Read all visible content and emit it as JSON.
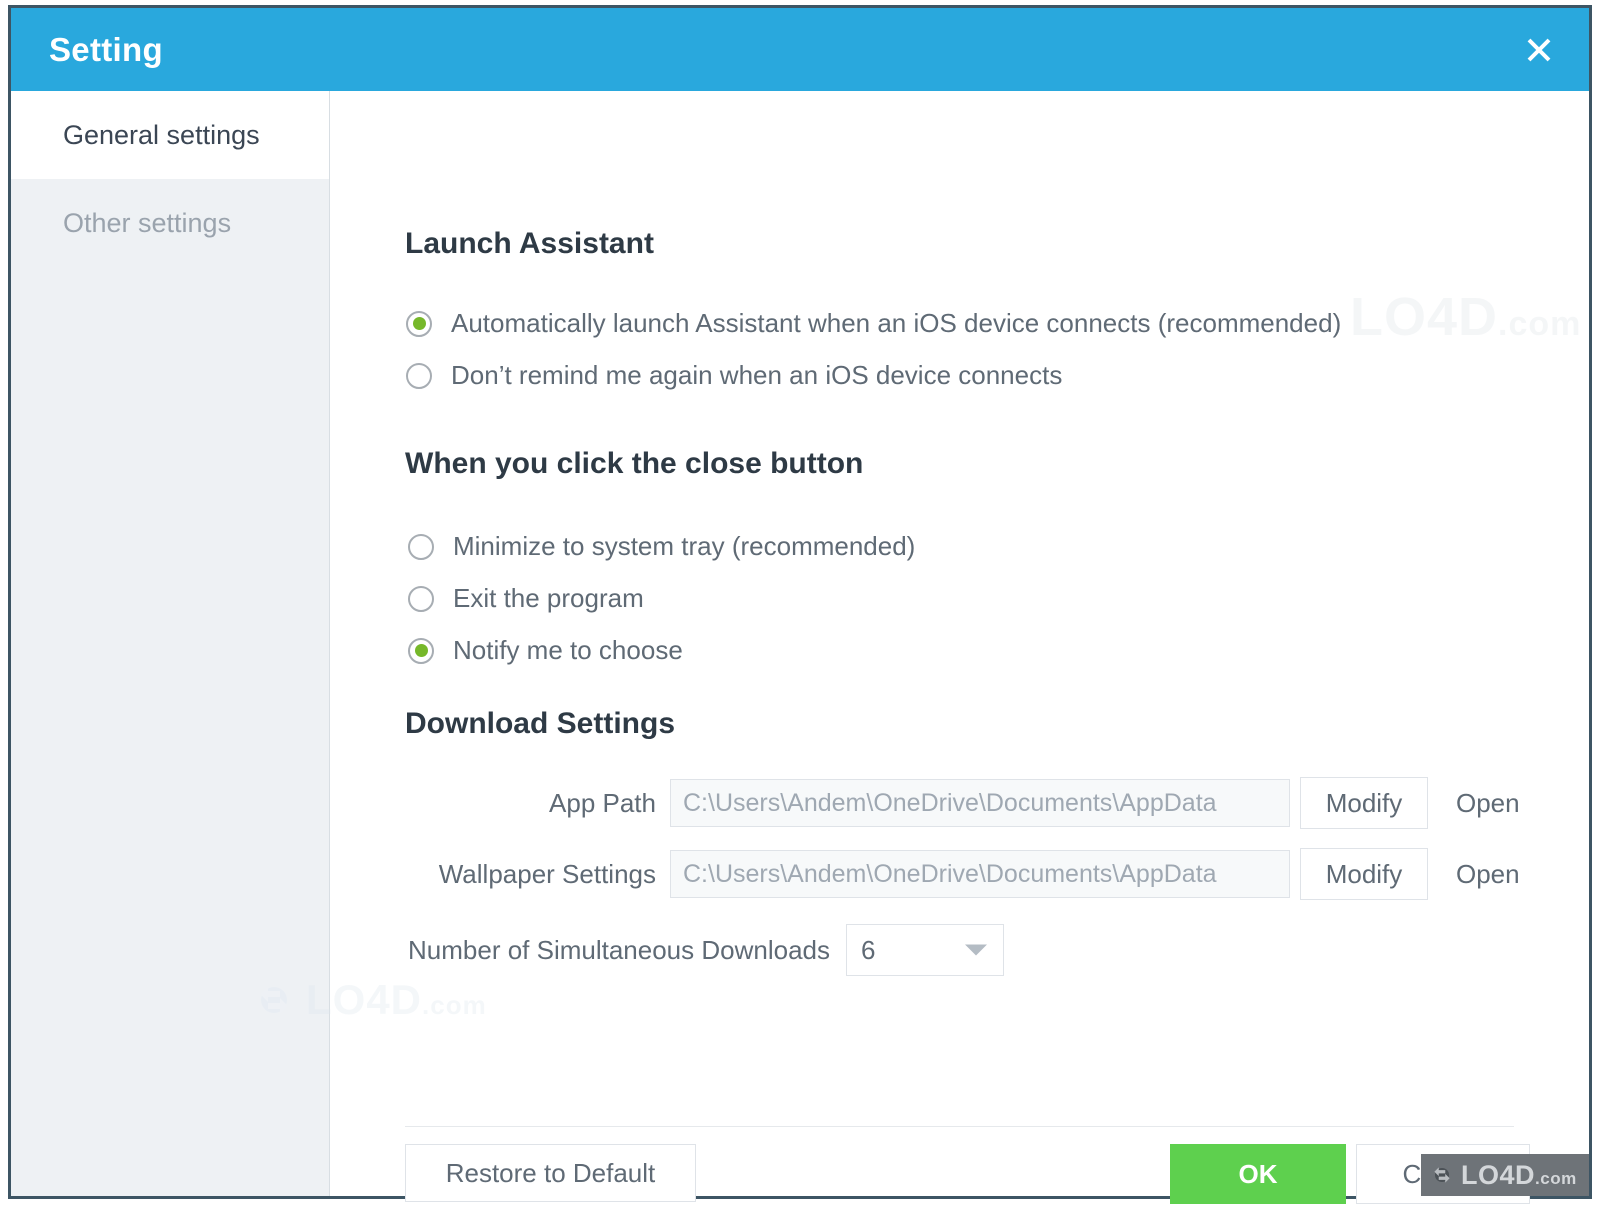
{
  "window": {
    "title": "Setting",
    "close_icon": "close-icon",
    "accent_color": "#29a8dd",
    "border_color": "#3d5564"
  },
  "sidebar": {
    "items": [
      {
        "label": "General settings",
        "active": true
      },
      {
        "label": "Other settings",
        "active": false
      }
    ]
  },
  "sections": {
    "launch_assistant": {
      "title": "Launch Assistant",
      "options": [
        {
          "label": "Automatically launch Assistant when an iOS device connects (recommended)",
          "selected": true
        },
        {
          "label": "Don’t remind me again when an iOS device connects",
          "selected": false
        }
      ]
    },
    "close_button": {
      "title": "When you click the close button",
      "options": [
        {
          "label": "Minimize to system tray (recommended)",
          "selected": false
        },
        {
          "label": "Exit the program",
          "selected": false
        },
        {
          "label": "Notify me to choose",
          "selected": true
        }
      ]
    },
    "download_settings": {
      "title": "Download Settings",
      "app_path": {
        "label": "App Path",
        "value": "C:\\Users\\Andem\\OneDrive\\Documents\\AppData",
        "modify_label": "Modify",
        "open_label": "Open"
      },
      "wallpaper_settings": {
        "label": "Wallpaper Settings",
        "value": "C:\\Users\\Andem\\OneDrive\\Documents\\AppData",
        "modify_label": "Modify",
        "open_label": "Open"
      },
      "simultaneous_downloads": {
        "label": "Number of Simultaneous Downloads",
        "value": "6",
        "caret_icon": "chevron-down-icon"
      }
    }
  },
  "footer": {
    "restore_label": "Restore to Default",
    "ok_label": "OK",
    "cancel_label": "Cancel",
    "ok_color": "#5ed04e"
  },
  "watermarks": {
    "brand": "LO4D",
    "suffix": ".com",
    "logo_icon": "lo4d-refresh-logo-icon"
  },
  "radio_colors": {
    "selected_dot": "#76b82a",
    "ring": "#a7adb3"
  }
}
